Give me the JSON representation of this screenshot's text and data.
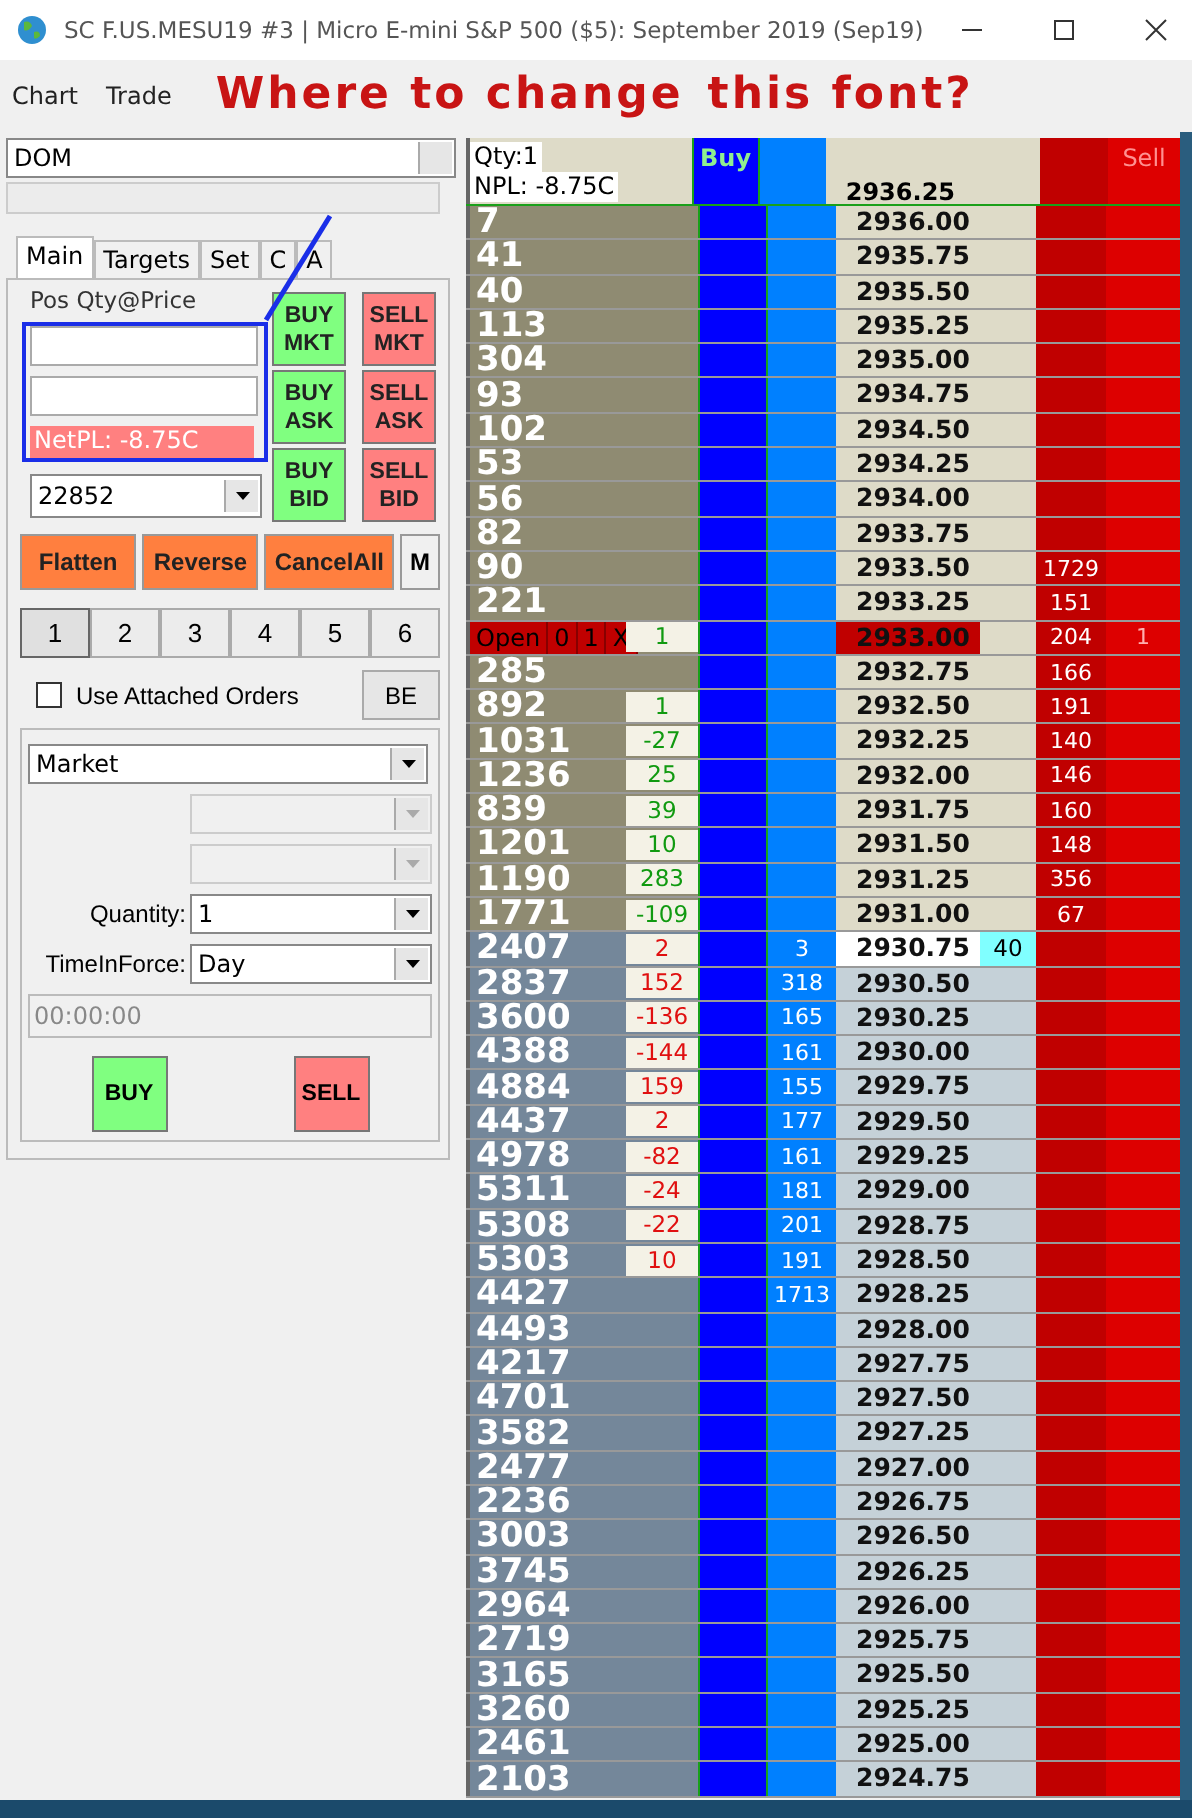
{
  "window": {
    "title": "SC F.US.MESU19  #3 | Micro E-mini S&P 500 ($5): September 2019 (Sep19)"
  },
  "menu": [
    "Chart",
    "Trade"
  ],
  "annotation": {
    "lines": [
      "Where to change",
      "this font?"
    ]
  },
  "left_panel": {
    "study": "DOM",
    "tabs": [
      {
        "label": "Main",
        "selected": true
      },
      {
        "label": "Targets",
        "selected": false
      },
      {
        "label": "Set",
        "selected": false
      },
      {
        "label": "C",
        "selected": false
      },
      {
        "label": "A",
        "selected": false
      }
    ],
    "pos_label": "Pos Qty@Price",
    "netpl": "NetPL: -8.75C",
    "account": "22852",
    "order_buttons": [
      {
        "kind": "buy",
        "label": "BUY MKT"
      },
      {
        "kind": "sell",
        "label": "SELL MKT"
      },
      {
        "kind": "buy",
        "label": "BUY ASK"
      },
      {
        "kind": "sell",
        "label": "SELL ASK"
      },
      {
        "kind": "buy",
        "label": "BUY BID"
      },
      {
        "kind": "sell",
        "label": "SELL BID"
      }
    ],
    "actions": [
      {
        "kind": "orange",
        "label": "Flatten"
      },
      {
        "kind": "orange",
        "label": "Reverse"
      },
      {
        "kind": "orange",
        "label": "CancelAll"
      },
      {
        "kind": "plain",
        "label": "M"
      }
    ],
    "numbers": [
      {
        "label": "1",
        "selected": true
      },
      {
        "label": "2",
        "selected": false
      },
      {
        "label": "3",
        "selected": false
      },
      {
        "label": "4",
        "selected": false
      },
      {
        "label": "5",
        "selected": false
      },
      {
        "label": "6",
        "selected": false
      }
    ],
    "attached": {
      "label": "Use Attached Orders",
      "checked": false
    },
    "be": "BE",
    "order_type": "Market",
    "quantity_label": "Quantity:",
    "quantity": "1",
    "tif_label": "TimeInForce:",
    "tif": "Day",
    "time": "00:00:00",
    "buy": "BUY",
    "sell": "SELL"
  },
  "dom": {
    "qty": "Qty:1",
    "npl": "NPL: -8.75C",
    "buy": "Buy",
    "sell": "Sell",
    "top_price": "2936.25",
    "rows": [
      {
        "kind": "ask",
        "volume": "7",
        "price": "2936.00"
      },
      {
        "kind": "ask",
        "volume": "41",
        "price": "2935.75"
      },
      {
        "kind": "ask",
        "volume": "40",
        "price": "2935.50"
      },
      {
        "kind": "ask",
        "volume": "113",
        "price": "2935.25"
      },
      {
        "kind": "ask",
        "volume": "304",
        "price": "2935.00"
      },
      {
        "kind": "ask",
        "volume": "93",
        "price": "2934.75"
      },
      {
        "kind": "ask",
        "volume": "102",
        "price": "2934.50"
      },
      {
        "kind": "ask",
        "volume": "53",
        "price": "2934.25"
      },
      {
        "kind": "ask",
        "volume": "56",
        "price": "2934.00"
      },
      {
        "kind": "ask",
        "volume": "82",
        "price": "2933.75"
      },
      {
        "kind": "ask",
        "volume": "90",
        "price": "2933.50",
        "ask": "1729"
      },
      {
        "kind": "ask",
        "volume": "221",
        "price": "2933.25",
        "ask": "151"
      },
      {
        "kind": "order",
        "order": [
          "Open",
          "0",
          "1",
          "X"
        ],
        "change": "1",
        "color": "#109a10",
        "price": "2933.00",
        "ask": "204",
        "sell": "1"
      },
      {
        "kind": "ask",
        "volume": "285",
        "price": "2932.75",
        "ask": "166"
      },
      {
        "kind": "ask",
        "volume": "892",
        "change": "1",
        "color": "#109a10",
        "price": "2932.50",
        "ask": "191"
      },
      {
        "kind": "ask",
        "volume": "1031",
        "change": "-27",
        "color": "#109a10",
        "price": "2932.25",
        "ask": "140"
      },
      {
        "kind": "ask",
        "volume": "1236",
        "change": "25",
        "color": "#109a10",
        "price": "2932.00",
        "ask": "146"
      },
      {
        "kind": "ask",
        "volume": "839",
        "change": "39",
        "color": "#109a10",
        "price": "2931.75",
        "ask": "160"
      },
      {
        "kind": "ask",
        "volume": "1201",
        "change": "10",
        "color": "#109a10",
        "price": "2931.50",
        "ask": "148"
      },
      {
        "kind": "ask",
        "volume": "1190",
        "change": "283",
        "color": "#109a10",
        "price": "2931.25",
        "ask": "356"
      },
      {
        "kind": "ask",
        "volume": "1771",
        "change": "-109",
        "color": "#109a10",
        "price": "2931.00",
        "ask": "67"
      },
      {
        "kind": "last",
        "volume": "2407",
        "change": "2",
        "color": "#e01010",
        "bid": "3",
        "price": "2930.75",
        "trade": "40"
      },
      {
        "kind": "bid",
        "volume": "2837",
        "change": "152",
        "color": "#e01010",
        "bid": "318",
        "price": "2930.50"
      },
      {
        "kind": "bid",
        "volume": "3600",
        "change": "-136",
        "color": "#e01010",
        "bid": "165",
        "price": "2930.25"
      },
      {
        "kind": "bid",
        "volume": "4388",
        "change": "-144",
        "color": "#e01010",
        "bid": "161",
        "price": "2930.00"
      },
      {
        "kind": "bid",
        "volume": "4884",
        "change": "159",
        "color": "#e01010",
        "bid": "155",
        "price": "2929.75"
      },
      {
        "kind": "bid",
        "volume": "4437",
        "change": "2",
        "color": "#e01010",
        "bid": "177",
        "price": "2929.50"
      },
      {
        "kind": "bid",
        "volume": "4978",
        "change": "-82",
        "color": "#e01010",
        "bid": "161",
        "price": "2929.25"
      },
      {
        "kind": "bid",
        "volume": "5311",
        "change": "-24",
        "color": "#e01010",
        "bid": "181",
        "price": "2929.00"
      },
      {
        "kind": "bid",
        "volume": "5308",
        "change": "-22",
        "color": "#e01010",
        "bid": "201",
        "price": "2928.75"
      },
      {
        "kind": "bid",
        "volume": "5303",
        "change": "10",
        "color": "#e01010",
        "bid": "191",
        "price": "2928.50"
      },
      {
        "kind": "bid",
        "volume": "4427",
        "bid": "1713",
        "price": "2928.25"
      },
      {
        "kind": "bid",
        "volume": "4493",
        "price": "2928.00"
      },
      {
        "kind": "bid",
        "volume": "4217",
        "price": "2927.75"
      },
      {
        "kind": "bid",
        "volume": "4701",
        "price": "2927.50"
      },
      {
        "kind": "bid",
        "volume": "3582",
        "price": "2927.25"
      },
      {
        "kind": "bid",
        "volume": "2477",
        "price": "2927.00"
      },
      {
        "kind": "bid",
        "volume": "2236",
        "price": "2926.75"
      },
      {
        "kind": "bid",
        "volume": "3003",
        "price": "2926.50"
      },
      {
        "kind": "bid",
        "volume": "3745",
        "price": "2926.25"
      },
      {
        "kind": "bid",
        "volume": "2964",
        "price": "2926.00"
      },
      {
        "kind": "bid",
        "volume": "2719",
        "price": "2925.75"
      },
      {
        "kind": "bid",
        "volume": "3165",
        "price": "2925.50"
      },
      {
        "kind": "bid",
        "volume": "3260",
        "price": "2925.25"
      },
      {
        "kind": "bid",
        "volume": "2461",
        "price": "2925.00"
      },
      {
        "kind": "bid",
        "volume": "2103",
        "price": "2924.75"
      }
    ]
  }
}
